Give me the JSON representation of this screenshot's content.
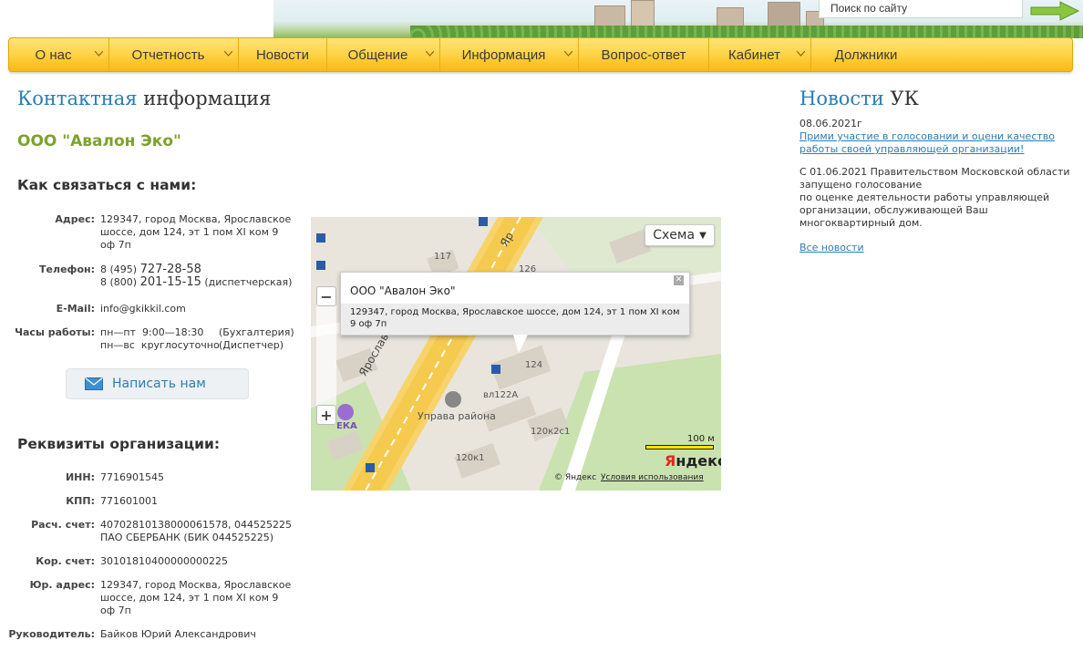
{
  "header": {
    "search_placeholder": "Поиск по сайту"
  },
  "nav": {
    "items": [
      {
        "label": "О нас"
      },
      {
        "label": "Отчетность"
      },
      {
        "label": "Новости"
      },
      {
        "label": "Общение"
      },
      {
        "label": "Информация"
      },
      {
        "label": "Вопрос-ответ"
      },
      {
        "label": "Кабинет"
      },
      {
        "label": "Должники"
      }
    ]
  },
  "page": {
    "title_accent": "Контактная",
    "title_rest": " информация",
    "org_name": "ООО \"Авалон Эко\"",
    "contact_heading": "Как связаться с нами:",
    "requisites_heading": "Реквизиты организации:"
  },
  "contacts": {
    "address_key": "Адрес:",
    "address_value": "129347, город Москва, Ярославское шоссе, дом 124, эт 1 пом XI ком 9 оф 7п",
    "phone_key": "Телефон:",
    "phone1_prefix": "8 (495) ",
    "phone1_number": "727-28-58",
    "phone2_prefix": "8 (800) ",
    "phone2_number": "201-15-15",
    "phone2_note": " (диспетчерская)",
    "email_key": "E-Mail:",
    "email_value": "info@gkikkil.com",
    "hours_key": "Часы работы:",
    "hours_row1_days": "пн—пт",
    "hours_row1_time": "9:00—18:30",
    "hours_row1_note": "(Бухгалтерия)",
    "hours_row2_days": "пн—вс",
    "hours_row2_time": "круглосуточно",
    "hours_row2_note": "(Диспетчер)",
    "write_button": "Написать нам"
  },
  "requisites": {
    "inn_key": "ИНН:",
    "inn_value": "7716901545",
    "kpp_key": "КПП:",
    "kpp_value": "771601001",
    "account_key": "Расч. счет:",
    "account_line1": "40702810138000061578, 044525225",
    "account_line2": "ПАО СБЕРБАНК (БИК 044525225)",
    "corr_key": "Кор. счет:",
    "corr_value": "30101810400000000225",
    "legal_key": "Юр. адрес:",
    "legal_value": "129347, город Москва, Ярославское шоссе, дом 124, эт 1 пом XI ком 9 оф 7п",
    "director_key": "Руководитель:",
    "director_value": "Байков Юрий Александрович"
  },
  "map": {
    "scheme_button": "Схема",
    "balloon_title": "ООО \"Авалон Эко\"",
    "balloon_address": "129347, город Москва, Ярославское шоссе, дом 124, эт 1 пом XI ком 9 оф 7п",
    "label_117": "117",
    "label_126": "126",
    "label_124": "124",
    "label_vl122a": "вл122А",
    "label_uprava": "Управа района",
    "label_120k2s1": "120к2с1",
    "label_120k1": "120к1",
    "label_eka": "ЕКА",
    "road_label_1": "Ярославское",
    "road_label_2": "Яр",
    "scale_label": "100 м",
    "logo_y": "Я",
    "logo_rest": "ндекс",
    "copyright": "© Яндекс",
    "terms": "Условия использования"
  },
  "news": {
    "title_accent": "Новости",
    "title_rest": " УК",
    "date": "08.06.2021г",
    "link": "Прими участие в голосовании и оцени качество работы своей управляющей организации!",
    "text_line1": "С 01.06.2021 Правительством Московской области запущено голосование",
    "text_line2": "по оценке деятельности работы управляющей организации, обслуживающей Ваш многоквартирный дом.",
    "all_link": "Все новости"
  }
}
